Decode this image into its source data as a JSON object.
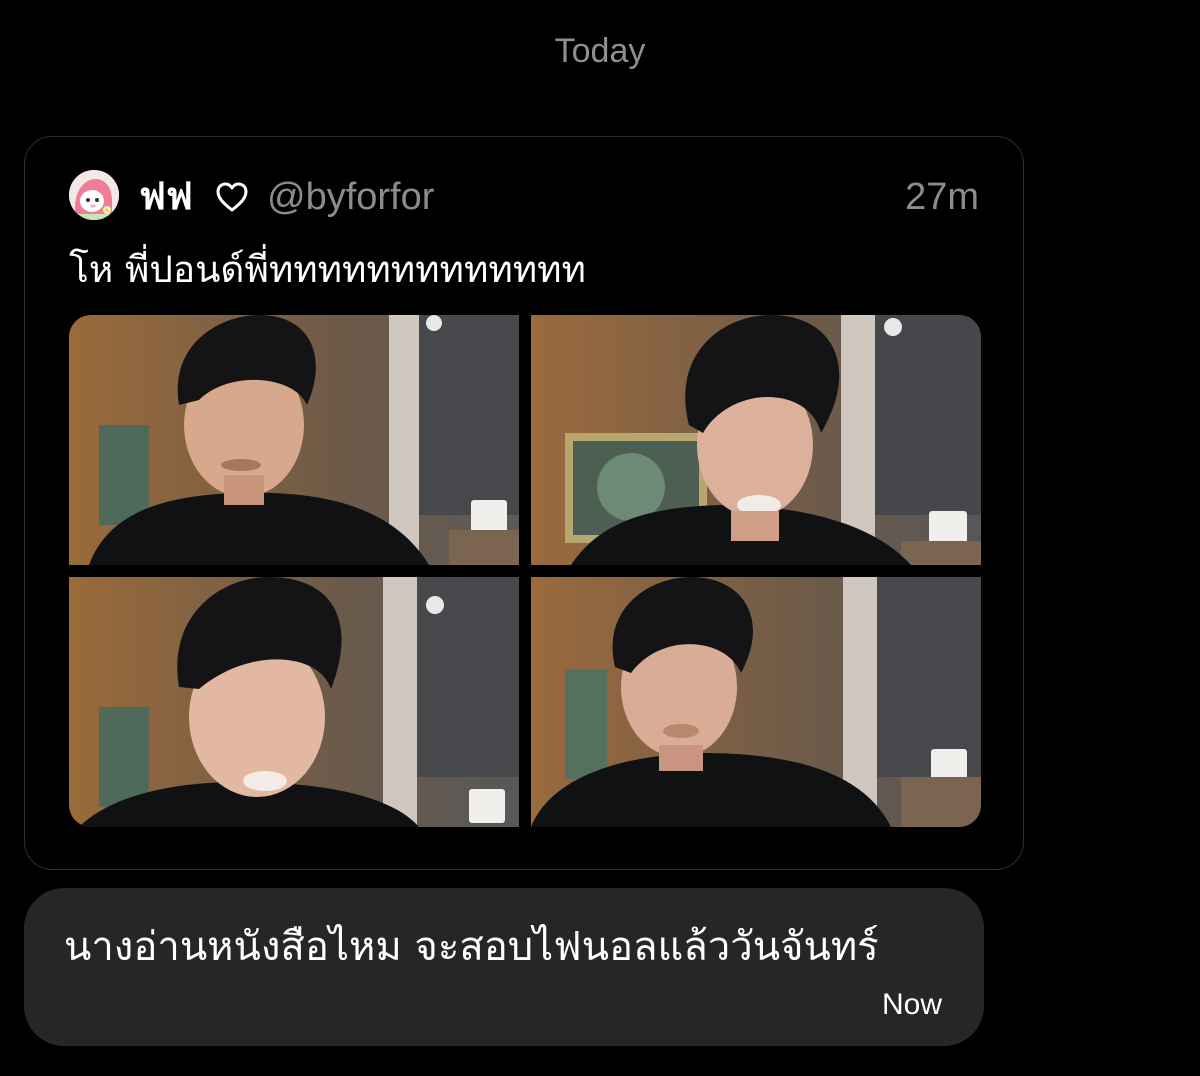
{
  "conversation": {
    "date_label": "Today"
  },
  "shared_tweet": {
    "display_name": "ฟฟ",
    "handle": "@byforfor",
    "time": "27m",
    "text": "โห พี่ปอนด์พี่ททททททททททททท",
    "avatar_icon": "avatar-pink-character-icon",
    "name_icon": "heart-outline-icon",
    "photos_count": 4
  },
  "reply_message": {
    "text": "นางอ่านหนังสือไหม จะสอบไฟนอลแล้ววันจันทร์",
    "time": "Now"
  },
  "colors": {
    "background": "#000000",
    "secondary_text": "#8e8e93",
    "card_border": "#2f2f33",
    "bubble": "#262628",
    "primary_text": "#ffffff"
  }
}
